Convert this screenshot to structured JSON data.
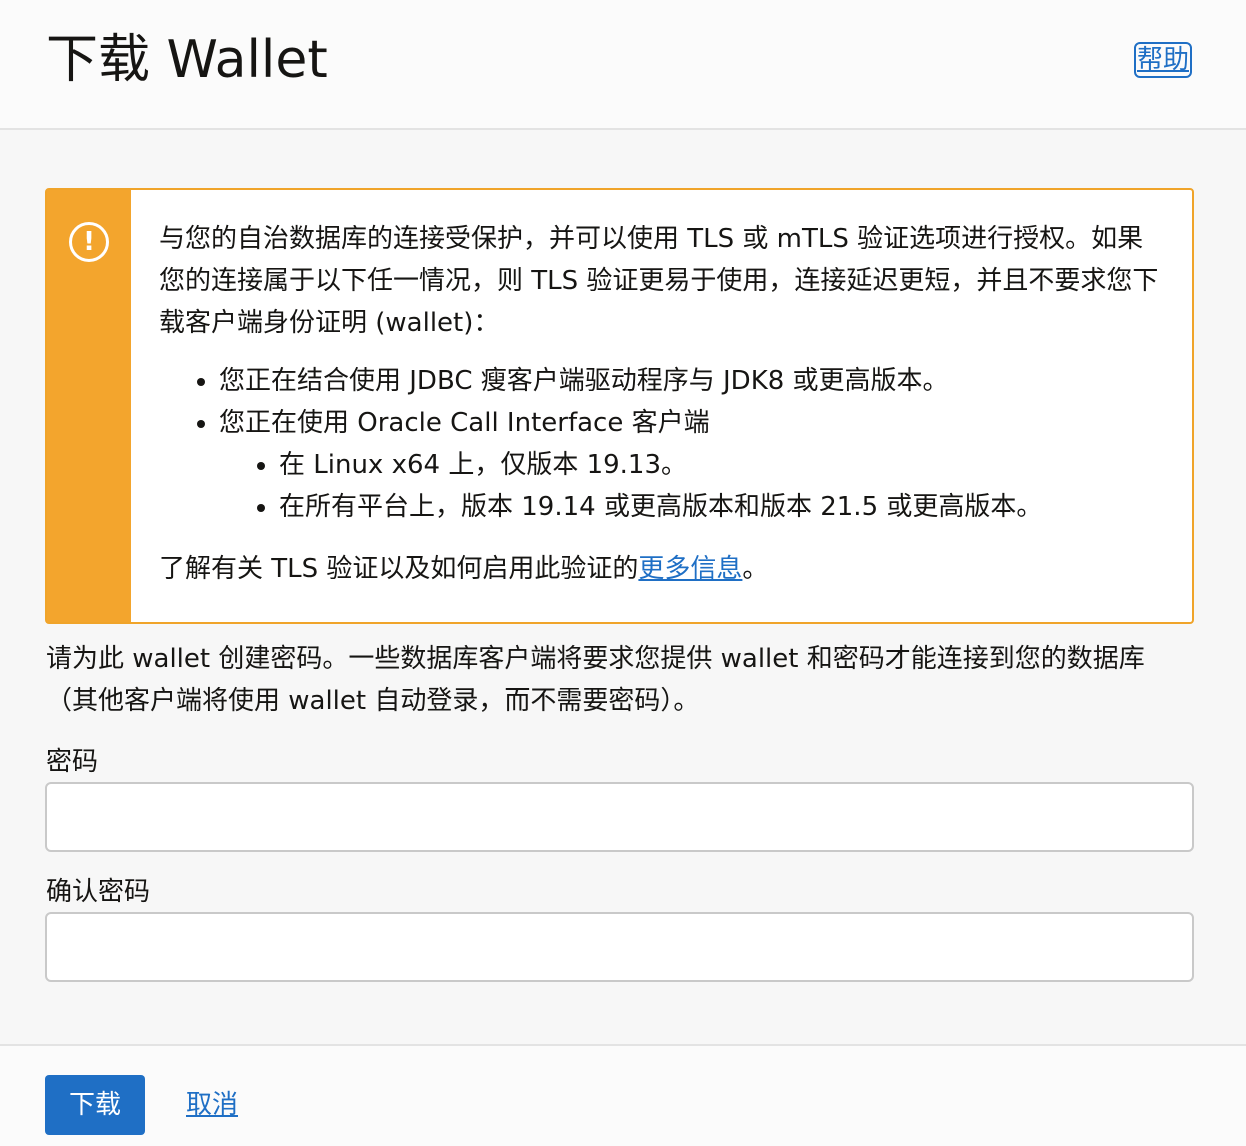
{
  "header": {
    "title": "下载 Wallet",
    "help_label": "帮助"
  },
  "alert": {
    "icon": "exclamation-circle-icon",
    "intro": "与您的自治数据库的连接受保护，并可以使用 TLS 或 mTLS 验证选项进行授权。如果您的连接属于以下任一情况，则 TLS 验证更易于使用，连接延迟更短，并且不要求您下载客户端身份证明 (wallet)：",
    "items": [
      {
        "text": "您正在结合使用 JDBC 瘦客户端驱动程序与 JDK8 或更高版本。"
      },
      {
        "text": "您正在使用 Oracle Call Interface 客户端",
        "subitems": [
          "在 Linux x64 上，仅版本 19.13。",
          "在所有平台上，版本 19.14 或更高版本和版本 21.5 或更高版本。"
        ]
      }
    ],
    "footer_prefix": "了解有关 TLS 验证以及如何启用此验证的",
    "footer_link": "更多信息",
    "footer_suffix": "。"
  },
  "instructions": "请为此 wallet 创建密码。一些数据库客户端将要求您提供 wallet 和密码才能连接到您的数据库（其他客户端将使用 wallet 自动登录，而不需要密码）。",
  "form": {
    "password_label": "密码",
    "password_value": "",
    "confirm_label": "确认密码",
    "confirm_value": ""
  },
  "footer": {
    "download_label": "下载",
    "cancel_label": "取消"
  },
  "colors": {
    "accent": "#1f6fc5",
    "warning": "#f3a52d"
  }
}
